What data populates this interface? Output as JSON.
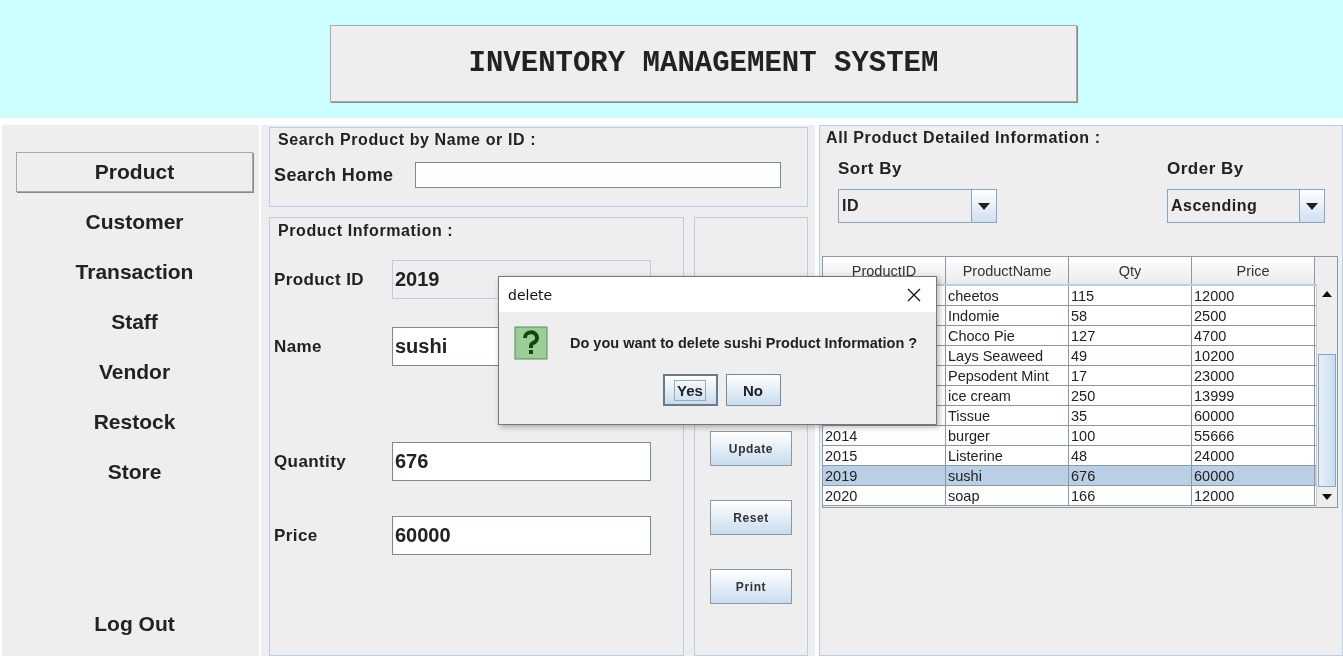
{
  "header": {
    "title": "INVENTORY MANAGEMENT SYSTEM"
  },
  "sidebar": {
    "items": [
      {
        "label": "Product",
        "selected": true
      },
      {
        "label": "Customer",
        "selected": false
      },
      {
        "label": "Transaction",
        "selected": false
      },
      {
        "label": "Staff",
        "selected": false
      },
      {
        "label": "Vendor",
        "selected": false
      },
      {
        "label": "Restock",
        "selected": false
      },
      {
        "label": "Store",
        "selected": false
      }
    ],
    "logout": "Log Out"
  },
  "search": {
    "title": "Search Product by Name or ID :",
    "label": "Search Home"
  },
  "product_info": {
    "title": "Product Information :",
    "fields": [
      {
        "label": "Product ID",
        "value": "2019",
        "editable": false
      },
      {
        "label": "Name",
        "value": "sushi",
        "editable": true
      },
      {
        "label": "Quantity",
        "value": "676",
        "editable": true
      },
      {
        "label": "Price",
        "value": "60000",
        "editable": true
      }
    ]
  },
  "actions": [
    "Update",
    "Reset",
    "Print"
  ],
  "details": {
    "title": "All Product Detailed Information :",
    "sort_by": {
      "label": "Sort By",
      "value": "ID"
    },
    "order_by": {
      "label": "Order By",
      "value": "Ascending"
    },
    "table": {
      "columns": [
        "ProductID",
        "ProductName",
        "Qty",
        "Price"
      ],
      "rows": [
        {
          "name": "cheetos",
          "qty": "115",
          "price": "12000",
          "selected": false
        },
        {
          "name": "Indomie",
          "qty": "58",
          "price": "2500",
          "selected": false
        },
        {
          "name": "Choco Pie",
          "qty": "127",
          "price": "4700",
          "selected": false
        },
        {
          "name": "Lays Seaweed",
          "qty": "49",
          "price": "10200",
          "selected": false
        },
        {
          "name": "Pepsodent Mint",
          "qty": "17",
          "price": "23000",
          "selected": false
        },
        {
          "name": "ice cream",
          "qty": "250",
          "price": "13999",
          "selected": false
        },
        {
          "name": "Tissue",
          "qty": "35",
          "price": "60000",
          "selected": false
        },
        {
          "id": "2014",
          "name": "burger",
          "qty": "100",
          "price": "55666",
          "selected": false
        },
        {
          "id": "2015",
          "name": "Listerine",
          "qty": "48",
          "price": "24000",
          "selected": false
        },
        {
          "id": "2019",
          "name": "sushi",
          "qty": "676",
          "price": "60000",
          "selected": true
        },
        {
          "id": "2020",
          "name": "soap",
          "qty": "166",
          "price": "12000",
          "selected": false
        }
      ]
    }
  },
  "dialog": {
    "title": "delete",
    "message": "Do you want to delete sushi Product Information ?",
    "buttons": [
      {
        "label": "Yes",
        "focused": true
      },
      {
        "label": "No",
        "focused": false
      }
    ]
  }
}
